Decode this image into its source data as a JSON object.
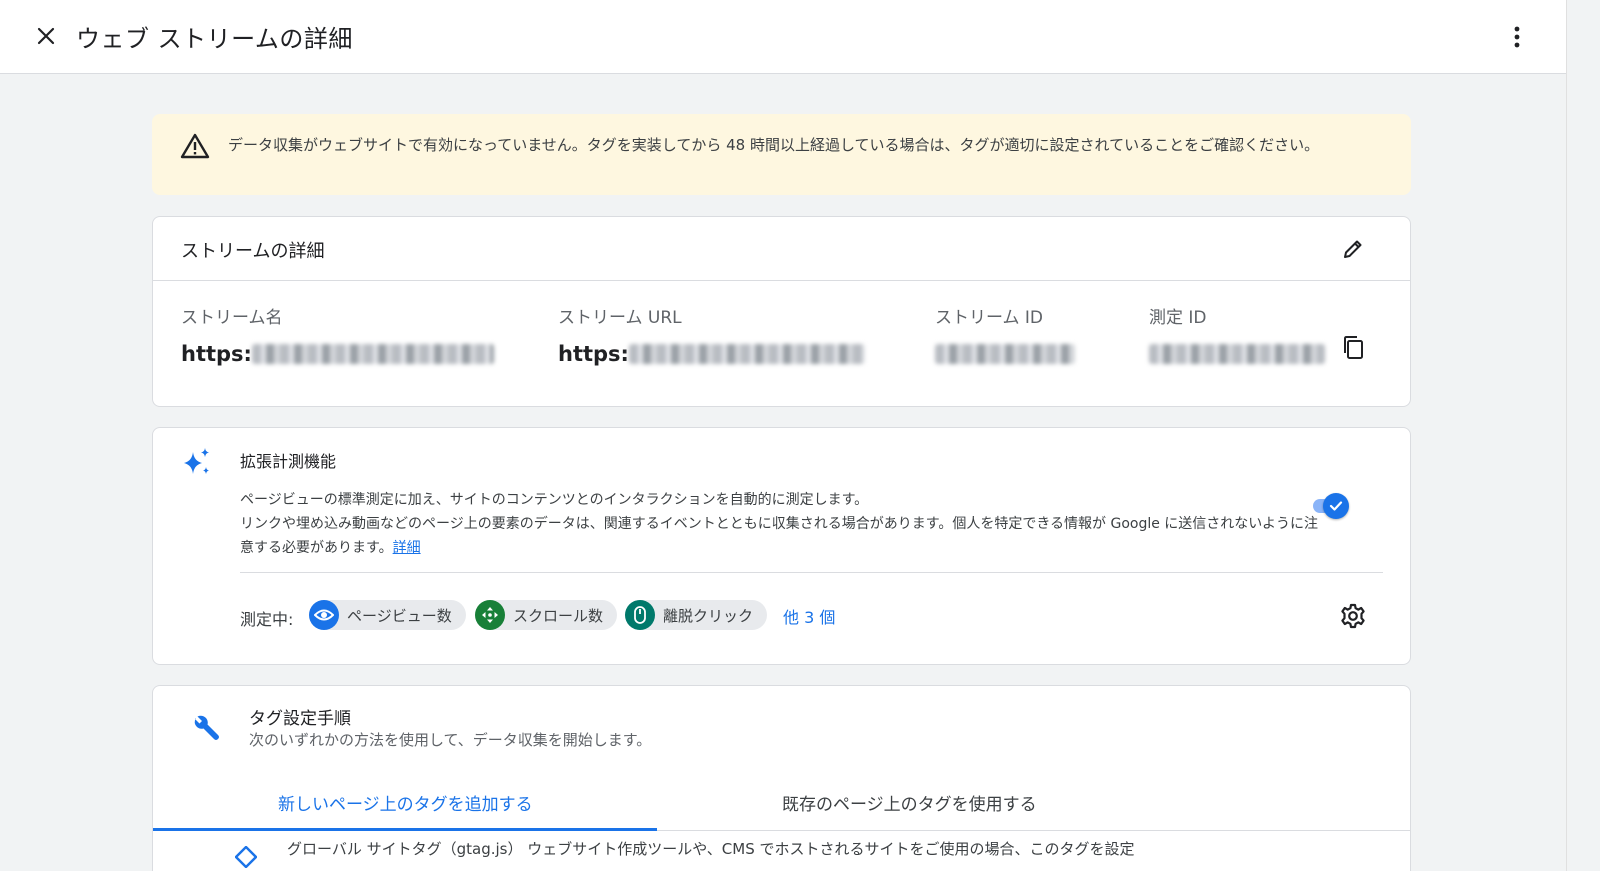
{
  "header": {
    "title": "ウェブ ストリームの詳細",
    "close_icon": "close-icon",
    "more_icon": "more-vert-icon"
  },
  "warning": {
    "icon": "warning-icon",
    "text": "データ収集がウェブサイトで有効になっていません。タグを実装してから 48 時間以上経過している場合は、タグが適切に設定されていることをご確認ください。"
  },
  "stream_details": {
    "title": "ストリームの詳細",
    "edit_icon": "edit-pencil-icon",
    "fields": [
      {
        "label": "ストリーム名",
        "value": "https:"
      },
      {
        "label": "ストリーム URL",
        "value": "https:"
      },
      {
        "label": "ストリーム ID",
        "value": ""
      },
      {
        "label": "測定 ID",
        "value": ""
      }
    ],
    "copy_icon": "copy-icon"
  },
  "enhanced": {
    "title": "拡張計測機能",
    "line1": "ページビューの標準測定に加え、サイトのコンテンツとのインタラクションを自動的に測定します。",
    "line2": "リンクや埋め込み動画などのページ上の要素のデータは、関連するイベントとともに収集される場合があります。個人を特定できる情報が Google に送信されないように注意する必要があります。",
    "link": "詳細",
    "toggle_on": true,
    "measuring_label": "測定中:",
    "chips": [
      {
        "label": "ページビュー数",
        "icon": "eye-icon",
        "color": "#1a73e8"
      },
      {
        "label": "スクロール数",
        "icon": "scroll-arrows-icon",
        "color": "#188038"
      },
      {
        "label": "離脱クリック",
        "icon": "mouse-icon",
        "color": "#00796b"
      }
    ],
    "more": "他 3 個",
    "settings_icon": "gear-icon"
  },
  "tagging": {
    "title": "タグ設定手順",
    "subtitle": "次のいずれかの方法を使用して、データ収集を開始します。",
    "tabs": [
      {
        "label": "新しいページ上のタグを追加する",
        "active": true
      },
      {
        "label": "既存のページ上のタグを使用する",
        "active": false
      }
    ],
    "gtag_text": "グローバル サイトタグ（gtag.js） ウェブサイト作成ツールや、CMS でホストされるサイトをご使用の場合、このタグを設定"
  },
  "colors": {
    "accent": "#1a73e8",
    "warning_bg": "#fef7e0",
    "page_bg": "#f1f3f4"
  }
}
